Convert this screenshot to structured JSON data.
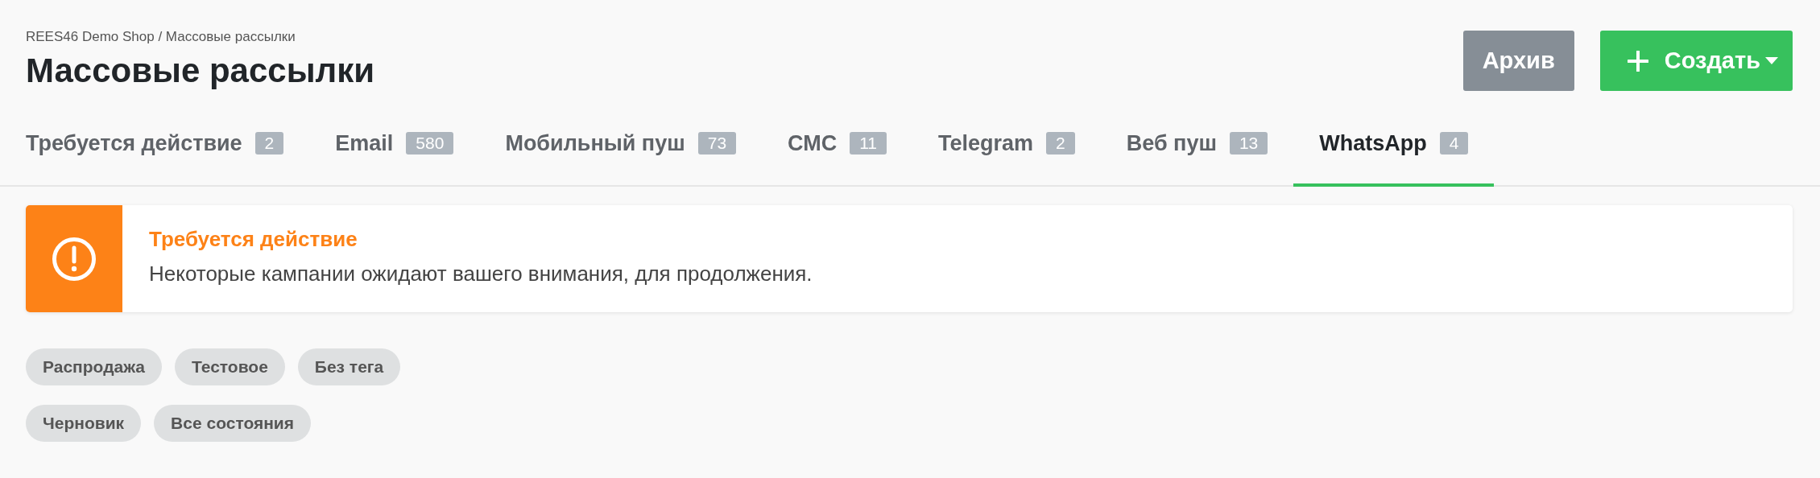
{
  "breadcrumb": "REES46 Demo Shop / Массовые рассылки",
  "title": "Массовые рассылки",
  "buttons": [
    {
      "kind": "secondary",
      "label": "Архив"
    },
    {
      "kind": "primary",
      "label": "Создать"
    }
  ],
  "tabs": [
    {
      "label": "Требуется действие",
      "count": "2",
      "selected": false
    },
    {
      "label": "Email",
      "count": "580",
      "selected": false
    },
    {
      "label": "Мобильный пуш",
      "count": "73",
      "selected": false
    },
    {
      "label": "СМС",
      "count": "11",
      "selected": false
    },
    {
      "label": "Telegram",
      "count": "2",
      "selected": false
    },
    {
      "label": "Веб пуш",
      "count": "13",
      "selected": false
    },
    {
      "label": "WhatsApp",
      "count": "4",
      "selected": true
    }
  ],
  "alert": {
    "kind": "warning",
    "title": "Требуется действие",
    "message": "Некоторые кампании ожидают вашего внимания, для продолжения."
  },
  "filter_rows": [
    {
      "chips": [
        {
          "label": "Распродажа"
        },
        {
          "label": "Тестовое"
        },
        {
          "label": "Без тега"
        }
      ]
    },
    {
      "chips": [
        {
          "label": "Черновик"
        },
        {
          "label": "Все состояния"
        }
      ]
    }
  ]
}
